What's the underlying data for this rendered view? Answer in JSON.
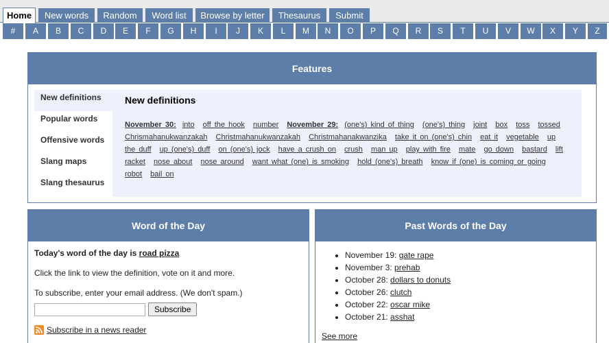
{
  "tabs": [
    {
      "label": "Home",
      "active": true
    },
    {
      "label": "New words"
    },
    {
      "label": "Random"
    },
    {
      "label": "Word list"
    },
    {
      "label": "Browse by letter"
    },
    {
      "label": "Thesaurus"
    },
    {
      "label": "Submit"
    }
  ],
  "letters": [
    "#",
    "A",
    "B",
    "C",
    "D",
    "E",
    "F",
    "G",
    "H",
    "I",
    "J",
    "K",
    "L",
    "M",
    "N",
    "O",
    "P",
    "Q",
    "R",
    "S",
    "T",
    "U",
    "V",
    "W",
    "X",
    "Y",
    "Z"
  ],
  "features": {
    "title": "Features",
    "side_items": [
      "New definitions",
      "Popular words",
      "Offensive words",
      "Slang maps",
      "Slang thesaurus"
    ],
    "content_title": "New definitions",
    "date1": "November 30",
    "date1_words": [
      "into",
      "off the hook",
      "number"
    ],
    "date2": "November 29",
    "date2_words": [
      "(one's) kind of thing",
      "(one's) thing",
      "joint",
      "box",
      "toss",
      "tossed",
      "Chrismahanukwanzakah",
      "Christmahanukwanzakah",
      "Christmahanakwanzika",
      "take it on (one's) chin",
      "eat it",
      "vegetable",
      "up the duff",
      "up (one's) duff",
      "on (one's) jock",
      "have a crush on",
      "crush",
      "man up",
      "play with fire",
      "mate",
      "go down",
      "bastard",
      "lift",
      "racket",
      "nose about",
      "nose around",
      "want what (one) is smoking",
      "hold (one's) breath",
      "know if (one) is coming or going",
      "robot",
      "bail on"
    ]
  },
  "wotd": {
    "title": "Word of the Day",
    "intro": "Today's word of the day is",
    "word": "road pizza",
    "click_text": "Click the link to view the definition, vote on it and more.",
    "subscribe_text": "To subscribe, enter your email address. (We don't spam.)",
    "subscribe_button": "Subscribe",
    "rss_link": "Subscribe in a news reader"
  },
  "past": {
    "title": "Past Words of the Day",
    "items": [
      {
        "date": "November 19:",
        "word": "gate rape"
      },
      {
        "date": "November 3:",
        "word": "prehab"
      },
      {
        "date": "October 28:",
        "word": "dollars to donuts"
      },
      {
        "date": "October 26:",
        "word": "clutch"
      },
      {
        "date": "October 22:",
        "word": "oscar mike"
      },
      {
        "date": "October 21:",
        "word": "asshat"
      }
    ],
    "see_more": "See more"
  },
  "colors": {
    "accent": "#5d7ea9",
    "feature_bg": "#eef0fc",
    "tabbar_bg": "#eaeaea",
    "rss": "#f08a24"
  }
}
